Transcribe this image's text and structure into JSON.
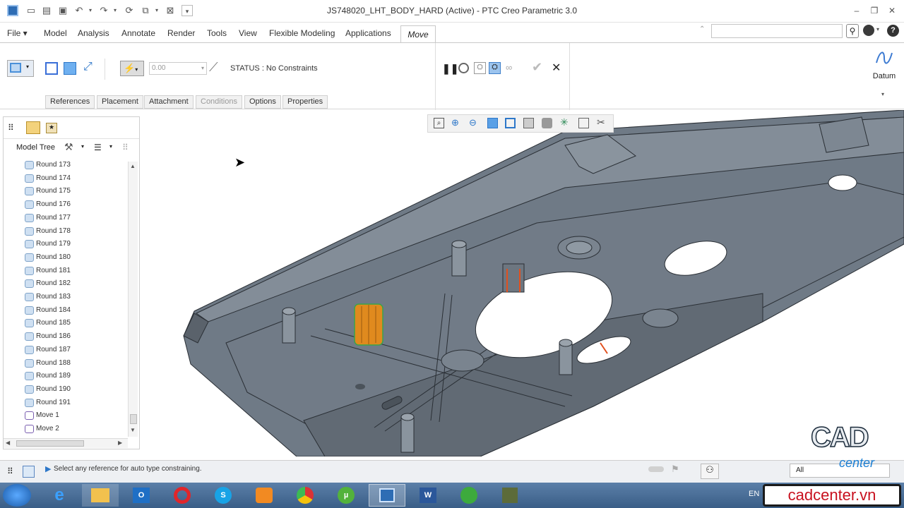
{
  "window": {
    "title": "JS748020_LHT_BODY_HARD (Active) - PTC Creo Parametric 3.0"
  },
  "ribbon": {
    "tabs": [
      "File",
      "Model",
      "Analysis",
      "Annotate",
      "Render",
      "Tools",
      "View",
      "Flexible Modeling",
      "Applications"
    ],
    "active_tab": "Move",
    "value_field": "0.00",
    "status_text": "STATUS : No Constraints",
    "datum_label": "Datum",
    "subtabs": [
      "References",
      "Placement",
      "Attachment",
      "Conditions",
      "Options",
      "Properties"
    ]
  },
  "model_tree": {
    "title": "Model Tree",
    "items": [
      "Round 173",
      "Round 174",
      "Round 175",
      "Round 176",
      "Round 177",
      "Round 178",
      "Round 179",
      "Round 180",
      "Round 181",
      "Round 182",
      "Round 183",
      "Round 184",
      "Round 185",
      "Round 186",
      "Round 187",
      "Round 188",
      "Round 189",
      "Round 190",
      "Round 191",
      "Move 1",
      "Move 2"
    ]
  },
  "status_bar": {
    "message": "Select any reference for auto type constraining.",
    "filter_value": "All"
  },
  "taskbar": {
    "language": "EN"
  },
  "watermark": {
    "logo_text": "CAD",
    "logo_sub": "center",
    "url": "cadcenter.vn"
  },
  "colors": {
    "model_gray": "#6f7a86",
    "highlight_orange": "#e08a1e",
    "accent_blue": "#3d7bd2"
  }
}
